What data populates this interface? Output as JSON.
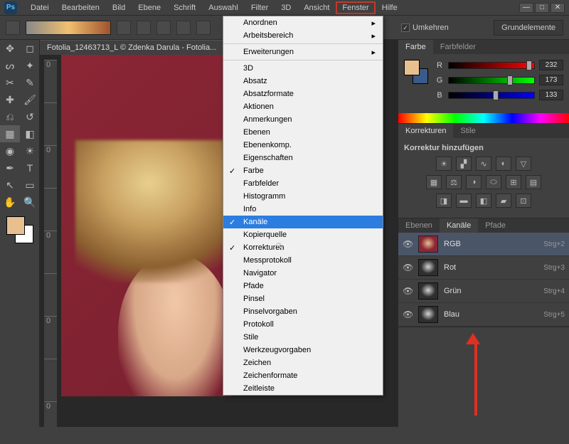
{
  "app": {
    "logo": "Ps"
  },
  "menubar": {
    "items": [
      "Datei",
      "Bearbeiten",
      "Bild",
      "Ebene",
      "Schrift",
      "Auswahl",
      "Filter",
      "3D",
      "Ansicht",
      "Fenster",
      "Hilfe"
    ],
    "highlighted_index": 9
  },
  "options_bar": {
    "reverse_label": "Umkehren",
    "workspace": "Grundelemente"
  },
  "document": {
    "tab_title": "Fotolia_12463713_L © Zdenka Darula - Fotolia..."
  },
  "dropdown": {
    "groups": [
      {
        "items": [
          {
            "label": "Anordnen",
            "sub": true
          },
          {
            "label": "Arbeitsbereich",
            "sub": true
          }
        ]
      },
      {
        "items": [
          {
            "label": "Erweiterungen",
            "sub": true
          }
        ]
      },
      {
        "items": [
          {
            "label": "3D"
          },
          {
            "label": "Absatz"
          },
          {
            "label": "Absatzformate"
          },
          {
            "label": "Aktionen"
          },
          {
            "label": "Anmerkungen"
          },
          {
            "label": "Ebenen"
          },
          {
            "label": "Ebenenkomp."
          },
          {
            "label": "Eigenschaften"
          },
          {
            "label": "Farbe",
            "checked": true
          },
          {
            "label": "Farbfelder"
          },
          {
            "label": "Histogramm"
          },
          {
            "label": "Info"
          },
          {
            "label": "Kanäle",
            "checked": true,
            "selected": true
          },
          {
            "label": "Kopierquelle"
          },
          {
            "label": "Korrekturen",
            "checked": true
          },
          {
            "label": "Messprotokoll"
          },
          {
            "label": "Navigator"
          },
          {
            "label": "Pfade"
          },
          {
            "label": "Pinsel"
          },
          {
            "label": "Pinselvorgaben"
          },
          {
            "label": "Protokoll"
          },
          {
            "label": "Stile"
          },
          {
            "label": "Werkzeugvorgaben"
          },
          {
            "label": "Zeichen"
          },
          {
            "label": "Zeichenformate"
          },
          {
            "label": "Zeitleiste"
          }
        ]
      }
    ]
  },
  "panels": {
    "color": {
      "tabs": [
        "Farbe",
        "Farbfelder"
      ],
      "sliders": [
        {
          "label": "R",
          "value": "232",
          "pct": 91,
          "bg": "linear-gradient(90deg,#000,#f00)"
        },
        {
          "label": "G",
          "value": "173",
          "pct": 68,
          "bg": "linear-gradient(90deg,#000,#0f0)"
        },
        {
          "label": "B",
          "value": "133",
          "pct": 52,
          "bg": "linear-gradient(90deg,#000,#00f)"
        }
      ]
    },
    "adjustments": {
      "tabs": [
        "Korrekturen",
        "Stile"
      ],
      "title": "Korrektur hinzufügen"
    },
    "channels": {
      "tabs": [
        "Ebenen",
        "Kanäle",
        "Pfade"
      ],
      "active_tab": 1,
      "rows": [
        {
          "name": "RGB",
          "shortcut": "Strg+2",
          "color": true,
          "sel": true
        },
        {
          "name": "Rot",
          "shortcut": "Strg+3"
        },
        {
          "name": "Grün",
          "shortcut": "Strg+4"
        },
        {
          "name": "Blau",
          "shortcut": "Strg+5"
        }
      ]
    }
  },
  "ruler_v": [
    "0",
    "",
    "0",
    "",
    "0",
    "",
    "0",
    "",
    "0"
  ]
}
